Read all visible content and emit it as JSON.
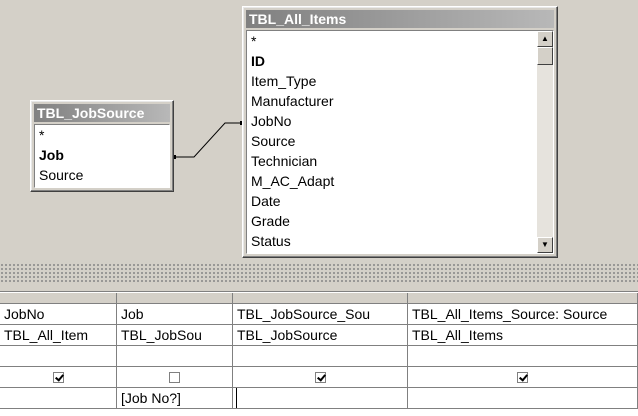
{
  "tables": {
    "jobsource": {
      "title": "TBL_JobSource",
      "fields": [
        {
          "label": "*",
          "key": false
        },
        {
          "label": "Job",
          "key": true
        },
        {
          "label": "Source",
          "key": false
        }
      ]
    },
    "all_items": {
      "title": "TBL_All_Items",
      "fields": [
        {
          "label": "*",
          "key": false
        },
        {
          "label": "ID",
          "key": true
        },
        {
          "label": "Item_Type",
          "key": false
        },
        {
          "label": "Manufacturer",
          "key": false
        },
        {
          "label": "JobNo",
          "key": false
        },
        {
          "label": "Source",
          "key": false
        },
        {
          "label": "Technician",
          "key": false
        },
        {
          "label": "M_AC_Adapt",
          "key": false
        },
        {
          "label": "Date",
          "key": false
        },
        {
          "label": "Grade",
          "key": false
        },
        {
          "label": "Status",
          "key": false
        }
      ]
    }
  },
  "icons": {
    "scroll_up": "▲",
    "scroll_down": "▼"
  },
  "grid": {
    "field_row": [
      "JobNo",
      "Job",
      "TBL_JobSource_Sou",
      "TBL_All_Items_Source: Source"
    ],
    "table_row": [
      "TBL_All_Item",
      "TBL_JobSou",
      "TBL_JobSource",
      "TBL_All_Items"
    ],
    "sort_row": [
      "",
      "",
      "",
      ""
    ],
    "show_row": [
      true,
      false,
      true,
      true
    ],
    "criteria_row": [
      "",
      "[Job No?]",
      "",
      ""
    ]
  }
}
